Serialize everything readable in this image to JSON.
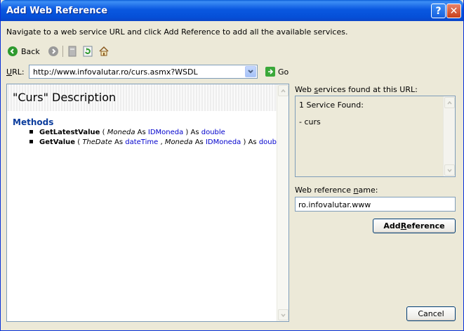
{
  "window": {
    "title": "Add Web Reference",
    "help_label": "?",
    "close_label": "✕"
  },
  "instructions": "Navigate to a web service URL and click Add Reference to add all the available services.",
  "toolbar": {
    "back_label": "Back",
    "icons": [
      "back-icon",
      "forward-icon",
      "stop-icon",
      "refresh-icon",
      "home-icon"
    ]
  },
  "url": {
    "label_u": "U",
    "label_rest": "RL:",
    "value": "http://www.infovalutar.ro/curs.asmx?WSDL",
    "go_label": "Go"
  },
  "browser": {
    "title": "\"Curs\" Description",
    "methods_title": "Methods",
    "methods": [
      {
        "name": "GetLatestValue",
        "open": " ( ",
        "p1_name": "Moneda",
        "as1": " As ",
        "p1_type": "IDMoneda",
        "close": " ) As ",
        "ret_type": "double"
      },
      {
        "name": "GetValue",
        "open": " ( ",
        "p1_name": "TheDate",
        "as1": " As ",
        "p1_type": "dateTime",
        "comma": " , ",
        "p2_name": "Moneda",
        "as2": " As ",
        "p2_type": "IDMoneda",
        "close": " ) As ",
        "ret_type": "double"
      }
    ]
  },
  "services": {
    "label_pre": "Web ",
    "label_u": "s",
    "label_post": "ervices found at this URL:",
    "found_text": "1 Service Found:",
    "item": "- curs"
  },
  "web_reference": {
    "label_pre": "Web reference ",
    "label_u": "n",
    "label_post": "ame:",
    "value": "ro.infovalutar.www"
  },
  "buttons": {
    "add_ref_pre": "Add ",
    "add_ref_u": "R",
    "add_ref_post": "eference",
    "cancel": "Cancel"
  },
  "colors": {
    "titlebar": "#0a58e0",
    "dialog_bg": "#ece9d8",
    "link_blue": "#0000cc",
    "methods_blue": "#0b3c9c"
  }
}
